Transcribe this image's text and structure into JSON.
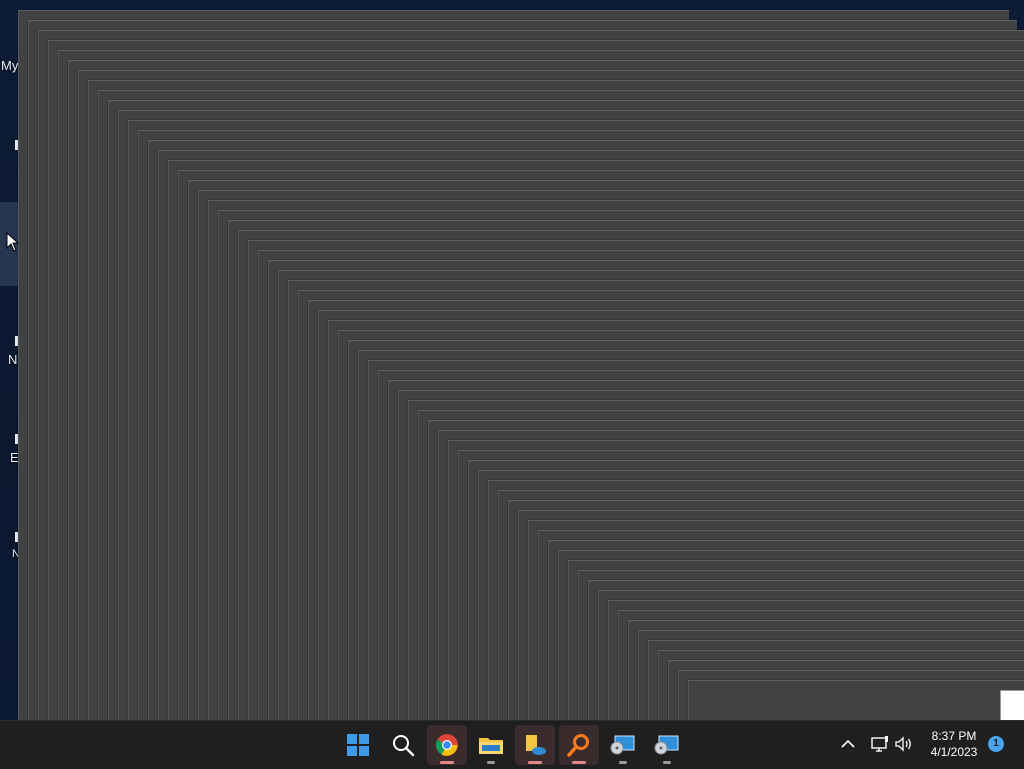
{
  "desktop": {
    "icon_labels": [
      "My",
      "N",
      "E",
      "N"
    ]
  },
  "taskbar": {
    "apps": [
      {
        "name": "start-button",
        "icon": "windows-logo-icon"
      },
      {
        "name": "search-button",
        "icon": "search-icon"
      },
      {
        "name": "chrome-button",
        "icon": "chrome-icon",
        "running": true,
        "active": true
      },
      {
        "name": "file-explorer-button",
        "icon": "folder-icon",
        "running": true
      },
      {
        "name": "file-sync-button",
        "icon": "file-cloud-icon",
        "running": true,
        "active": true
      },
      {
        "name": "search-app-button",
        "icon": "magnifier-orange-icon",
        "running": true,
        "active": true
      },
      {
        "name": "disk-app-button-1",
        "icon": "disk-monitor-icon",
        "running": true
      },
      {
        "name": "disk-app-button-2",
        "icon": "disk-monitor-icon",
        "running": true
      }
    ]
  },
  "tray": {
    "time": "8:37 PM",
    "date": "4/1/2023",
    "notification_count": "1",
    "icons": [
      "chevron-up-icon",
      "network-icon",
      "volume-icon"
    ]
  },
  "colors": {
    "desktop_bg": "#0b1a33",
    "window_bg": "#414243",
    "taskbar_bg": "#1f1f1f",
    "accent_blue": "#4aa3e8"
  }
}
